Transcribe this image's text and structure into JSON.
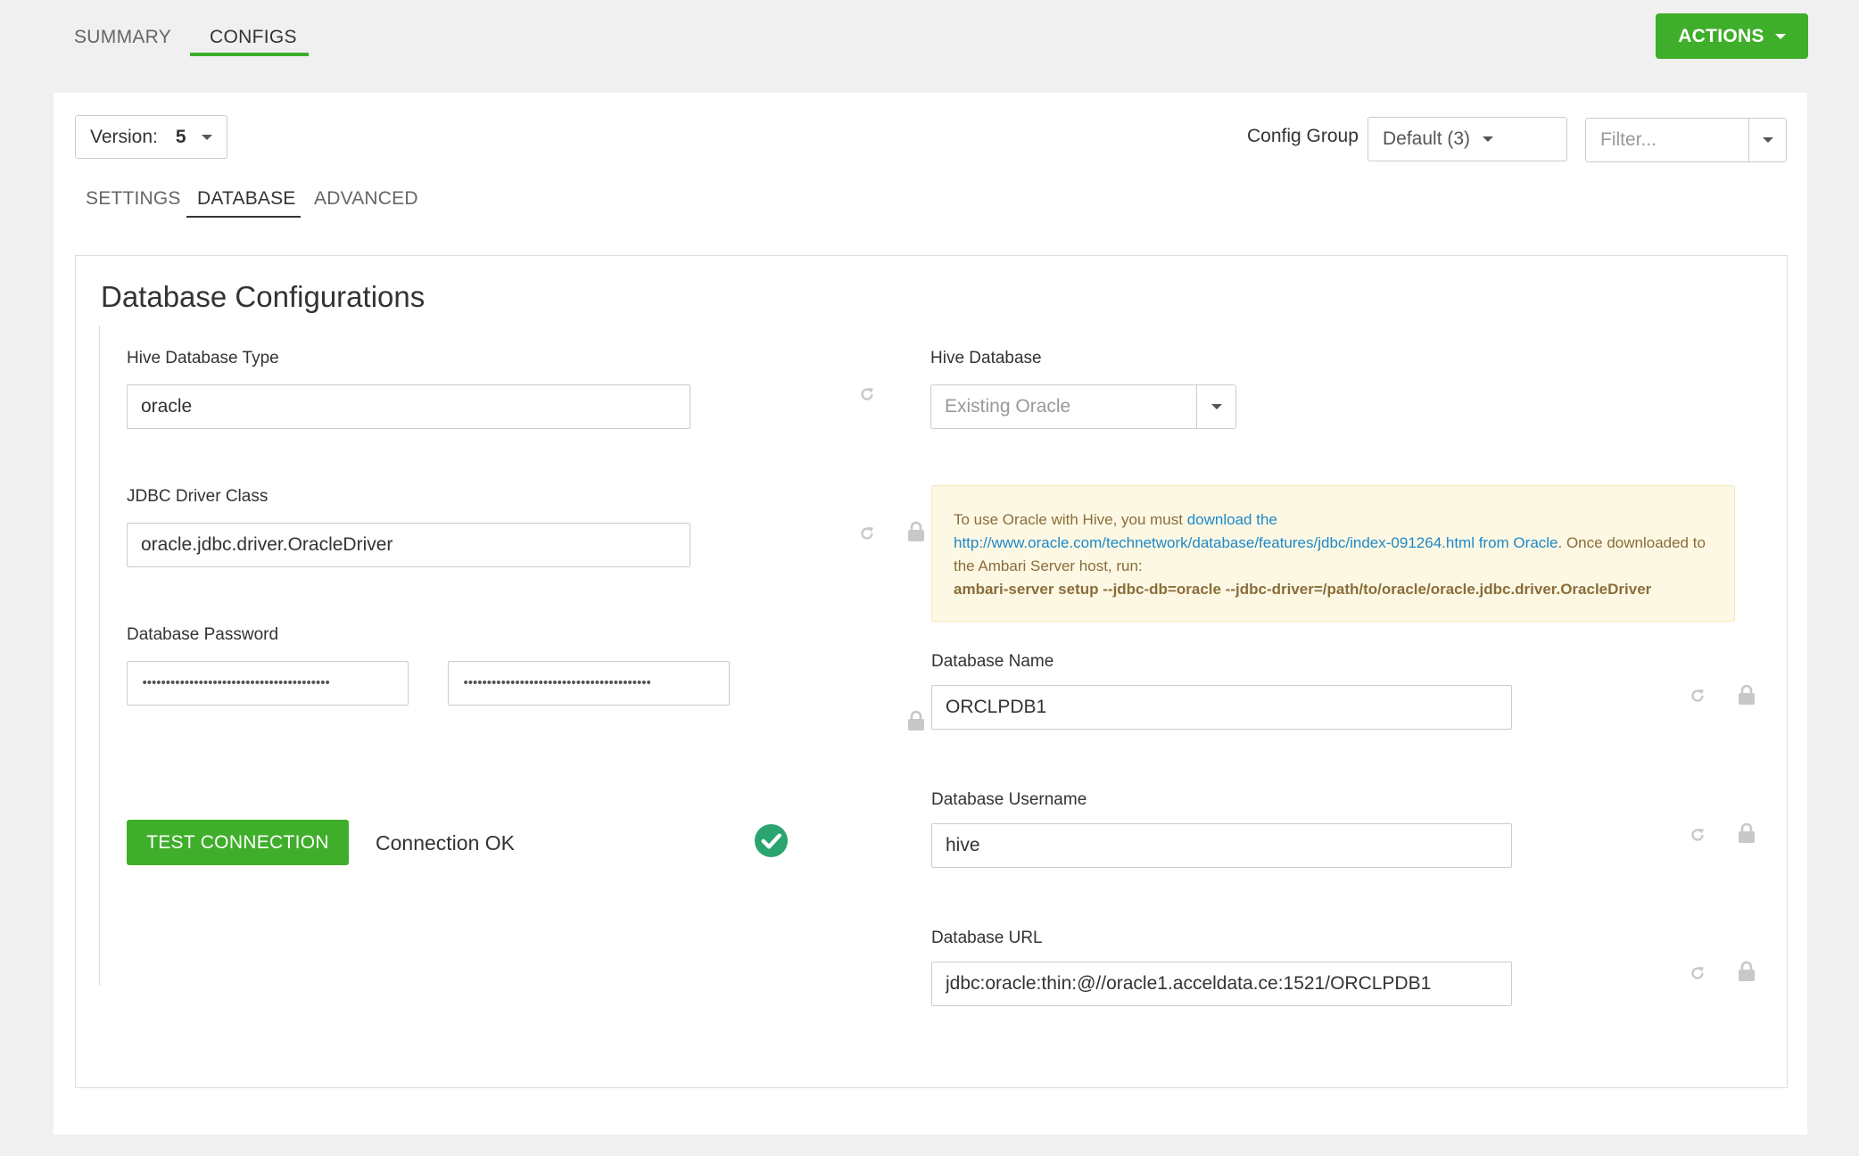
{
  "top_nav": {
    "tabs": [
      {
        "label": "SUMMARY",
        "active": false
      },
      {
        "label": "CONFIGS",
        "active": true
      }
    ],
    "actions_label": "ACTIONS"
  },
  "toolbar": {
    "version_label": "Version:",
    "version_value": "5",
    "config_group_label": "Config Group",
    "config_group_value": "Default (3)",
    "filter_placeholder": "Filter..."
  },
  "sub_tabs": [
    {
      "label": "SETTINGS",
      "active": false
    },
    {
      "label": "DATABASE",
      "active": true
    },
    {
      "label": "ADVANCED",
      "active": false
    }
  ],
  "section": {
    "title": "Database Configurations",
    "hive_db_type": {
      "label": "Hive Database Type",
      "value": "oracle"
    },
    "jdbc_driver": {
      "label": "JDBC Driver Class",
      "value": "oracle.jdbc.driver.OracleDriver"
    },
    "db_password": {
      "label": "Database Password",
      "value": "••••••••••••••••••••••••••••••••••••••••",
      "confirm_value": "••••••••••••••••••••••••••••••••••••••••"
    },
    "test_connection_label": "TEST CONNECTION",
    "connection_status": "Connection OK",
    "hive_database": {
      "label": "Hive Database",
      "value": "Existing Oracle"
    },
    "alert": {
      "text_1": "To use Oracle with Hive, you must ",
      "link_1": "download the",
      "link_2": "http://www.oracle.com/technetwork/database/features/jdbc/index-091264.html from Oracle",
      "text_2": ". Once downloaded to the Ambari Server host, run:",
      "command": "ambari-server setup --jdbc-db=oracle --jdbc-driver=/path/to/oracle/oracle.jdbc.driver.OracleDriver"
    },
    "db_name": {
      "label": "Database Name",
      "value": "ORCLPDB1"
    },
    "db_username": {
      "label": "Database Username",
      "value": "hive"
    },
    "db_url": {
      "label": "Database URL",
      "value": "jdbc:oracle:thin:@//oracle1.acceldata.ce:1521/ORCLPDB1"
    }
  },
  "colors": {
    "accent_green": "#3fae2a",
    "link_blue": "#1e88c9",
    "alert_bg": "#fcf8e3",
    "alert_text": "#8a6d3b",
    "ok_green": "#2aa56f"
  },
  "icons": [
    "chevron-down-icon",
    "undo-icon",
    "lock-icon",
    "check-circle-icon"
  ]
}
